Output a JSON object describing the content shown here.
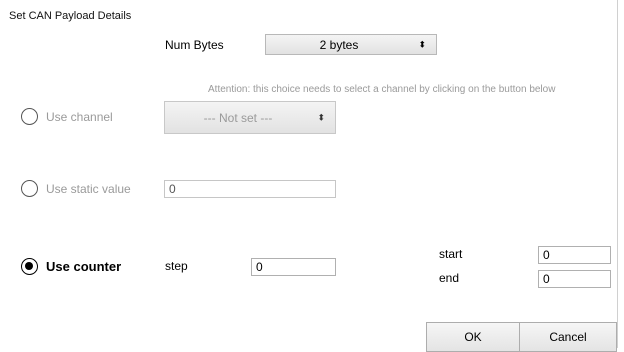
{
  "dialog": {
    "title": "Set CAN Payload Details"
  },
  "num_bytes": {
    "label": "Num Bytes",
    "selected": "2 bytes",
    "arrow": "⬍"
  },
  "attention": "Attention: this choice needs to select a channel by clicking on the button below",
  "use_channel": {
    "label": "Use channel",
    "selected": "--- Not set ---",
    "arrow": "⬍"
  },
  "use_static": {
    "label": "Use static value",
    "value": "0"
  },
  "use_counter": {
    "label": "Use counter",
    "step_label": "step",
    "step_value": "0",
    "start_label": "start",
    "start_value": "0",
    "end_label": "end",
    "end_value": "0"
  },
  "buttons": {
    "ok": "OK",
    "cancel": "Cancel"
  }
}
